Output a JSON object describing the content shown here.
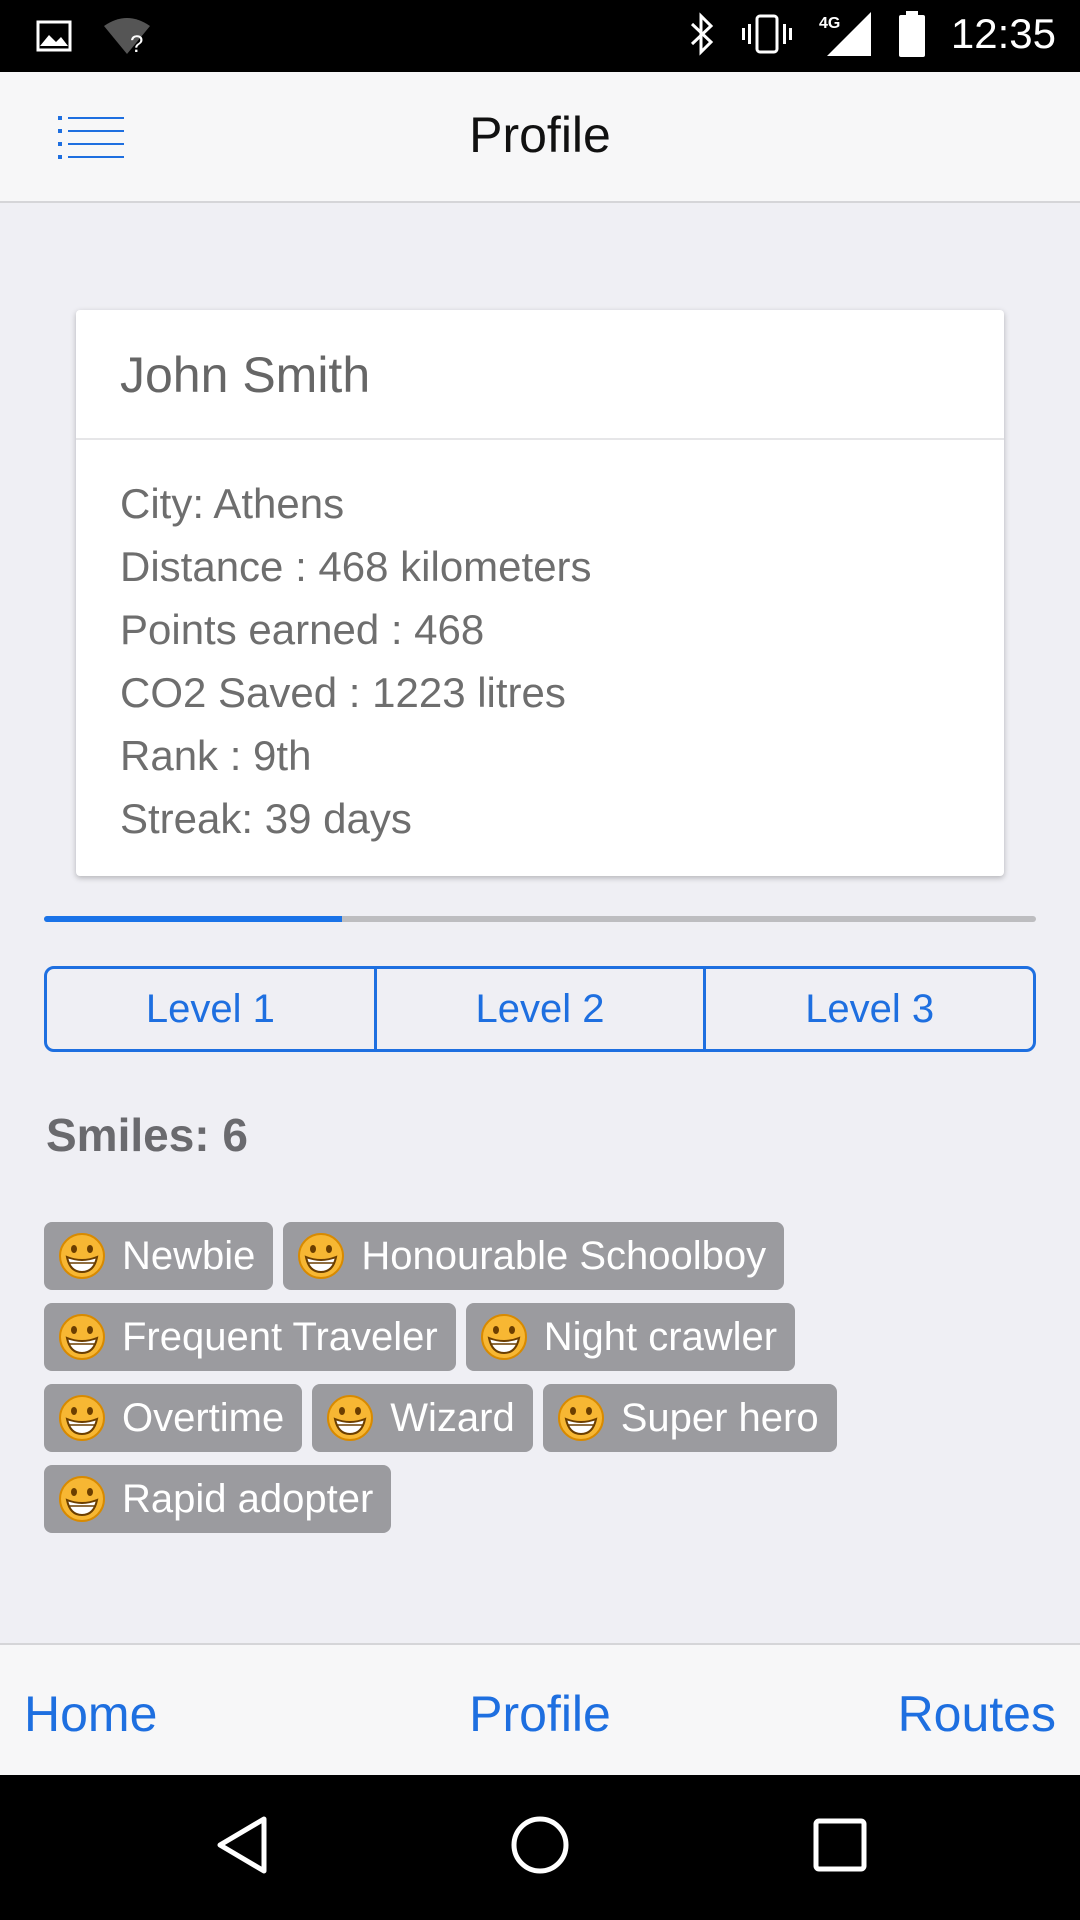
{
  "status_bar": {
    "time": "12:35",
    "network": "4G",
    "icons": [
      "image-icon",
      "wifi-unknown-icon",
      "bluetooth-icon",
      "vibrate-icon",
      "signal-icon",
      "battery-icon"
    ]
  },
  "header": {
    "title": "Profile",
    "menu_icon": "menu-list-icon"
  },
  "profile": {
    "name": "John Smith",
    "stats": {
      "city": "City: Athens",
      "distance": "Distance : 468 kilometers",
      "points": "Points earned : 468",
      "co2": "CO2 Saved : 1223 litres",
      "rank": "Rank : 9th",
      "streak": "Streak: 39 days"
    }
  },
  "level_progress": {
    "fraction": 0.3
  },
  "levels": {
    "level1": "Level 1",
    "level2": "Level 2",
    "level3": "Level 3"
  },
  "smiles": {
    "title": "Smiles: 6",
    "badge_icon": "grinning-face-icon",
    "badges": {
      "b0": "Newbie",
      "b1": "Honourable Schoolboy",
      "b2": "Frequent Traveler",
      "b3": "Night crawler",
      "b4": "Overtime",
      "b5": "Wizard",
      "b6": "Super hero",
      "b7": "Rapid adopter"
    }
  },
  "tab_bar": {
    "home": "Home",
    "profile": "Profile",
    "routes": "Routes"
  },
  "colors": {
    "accent": "#1e6fe0",
    "badge_bg": "#9b9b9f",
    "page_bg": "#efeff4"
  }
}
